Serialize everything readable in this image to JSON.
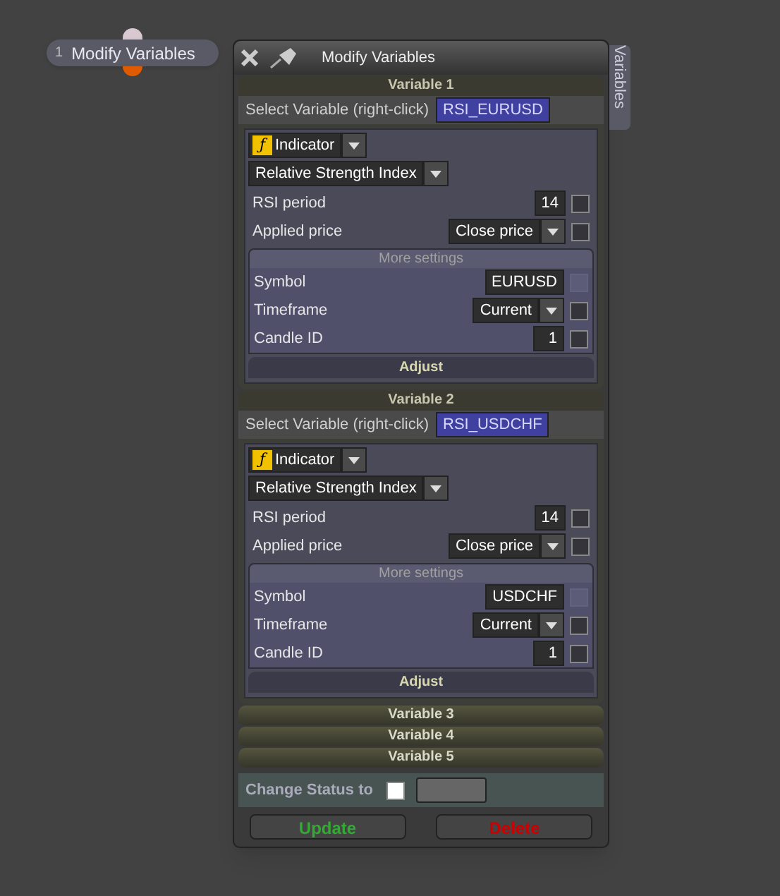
{
  "node": {
    "number": "1",
    "label": "Modify Variables"
  },
  "window": {
    "title": "Modify Variables",
    "side_tab": "Variables"
  },
  "variables": [
    {
      "header": "Variable 1",
      "expanded": true,
      "select_label": "Select Variable (right-click)",
      "variable_name": "RSI_EURUSD",
      "source_icon": "ƒ",
      "source": "Indicator",
      "indicator": "Relative Strength Index",
      "params": [
        {
          "kind": "number",
          "label": "RSI period",
          "value": "14",
          "checked": false,
          "disabled": false
        },
        {
          "kind": "dropdown",
          "label": "Applied price",
          "value": "Close price",
          "checked": false,
          "disabled": false
        }
      ],
      "more_settings": {
        "title": "More settings",
        "rows": [
          {
            "kind": "number",
            "label": "Symbol",
            "value": "EURUSD",
            "checked": false,
            "disabled": true
          },
          {
            "kind": "dropdown",
            "label": "Timeframe",
            "value": "Current",
            "checked": false,
            "disabled": false
          },
          {
            "kind": "number",
            "label": "Candle ID",
            "value": "1",
            "checked": false,
            "disabled": false
          }
        ]
      },
      "adjust": "Adjust"
    },
    {
      "header": "Variable 2",
      "expanded": true,
      "select_label": "Select Variable (right-click)",
      "variable_name": "RSI_USDCHF",
      "source_icon": "ƒ",
      "source": "Indicator",
      "indicator": "Relative Strength Index",
      "params": [
        {
          "kind": "number",
          "label": "RSI period",
          "value": "14",
          "checked": false,
          "disabled": false
        },
        {
          "kind": "dropdown",
          "label": "Applied price",
          "value": "Close price",
          "checked": false,
          "disabled": false
        }
      ],
      "more_settings": {
        "title": "More settings",
        "rows": [
          {
            "kind": "number",
            "label": "Symbol",
            "value": "USDCHF",
            "checked": false,
            "disabled": true
          },
          {
            "kind": "dropdown",
            "label": "Timeframe",
            "value": "Current",
            "checked": false,
            "disabled": false
          },
          {
            "kind": "number",
            "label": "Candle ID",
            "value": "1",
            "checked": false,
            "disabled": false
          }
        ]
      },
      "adjust": "Adjust"
    },
    {
      "header": "Variable 3",
      "expanded": false
    },
    {
      "header": "Variable 4",
      "expanded": false
    },
    {
      "header": "Variable 5",
      "expanded": false
    }
  ],
  "status": {
    "label": "Change Status to",
    "checked": false
  },
  "buttons": [
    {
      "kind": "update",
      "label": "Update"
    },
    {
      "kind": "delete",
      "label": "Delete"
    }
  ]
}
